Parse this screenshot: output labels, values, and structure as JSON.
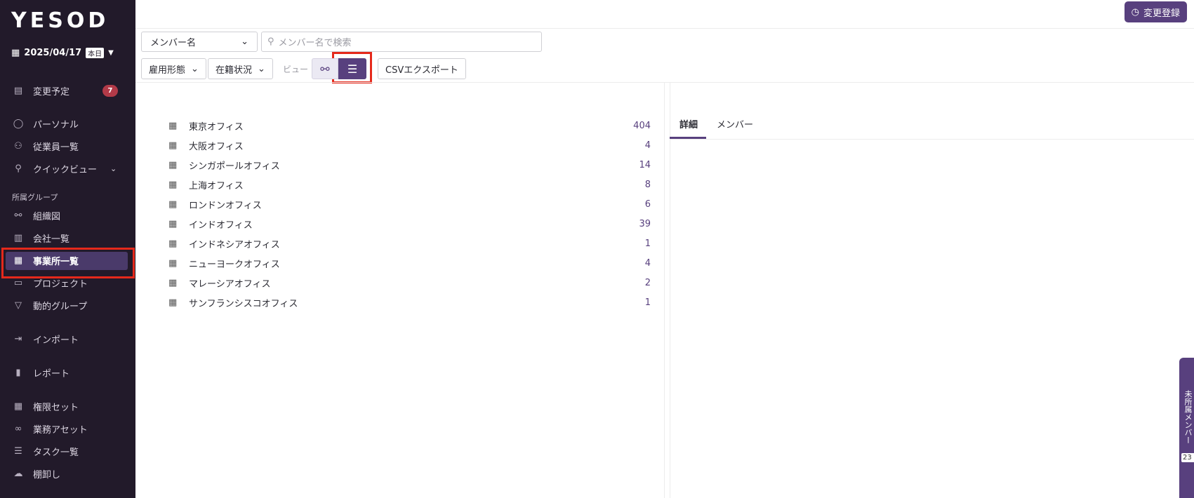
{
  "app": {
    "logo": "YESOD"
  },
  "date": {
    "value": "2025/04/17",
    "today_badge": "本日"
  },
  "sidebar": {
    "items": [
      {
        "label": "変更予定",
        "icon": "document-check-icon",
        "badge": "7"
      },
      {
        "label": "パーソナル",
        "icon": "user-icon"
      },
      {
        "label": "従業員一覧",
        "icon": "users-icon"
      },
      {
        "label": "クイックビュー",
        "icon": "search-icon"
      },
      {
        "label": "組織図",
        "icon": "org-chart-icon"
      },
      {
        "label": "会社一覧",
        "icon": "company-icon"
      },
      {
        "label": "事業所一覧",
        "icon": "building-icon"
      },
      {
        "label": "プロジェクト",
        "icon": "briefcase-icon"
      },
      {
        "label": "動的グループ",
        "icon": "filter-icon"
      },
      {
        "label": "インポート",
        "icon": "import-icon"
      },
      {
        "label": "レポート",
        "icon": "bar-chart-icon"
      },
      {
        "label": "権限セット",
        "icon": "table-icon"
      },
      {
        "label": "業務アセット",
        "icon": "link-icon"
      },
      {
        "label": "タスク一覧",
        "icon": "checklist-icon"
      },
      {
        "label": "棚卸し",
        "icon": "cloud-download-icon"
      }
    ],
    "section_label": "所属グループ"
  },
  "header": {
    "register_button": "変更登録"
  },
  "filters": {
    "field_select": "メンバー名",
    "search_placeholder": "メンバー名で検索",
    "employment_type": "雇用形態",
    "status": "在籍状況",
    "view_label": "ビュー",
    "csv_export": "CSVエクスポート"
  },
  "offices": [
    {
      "name": "東京オフィス",
      "count": "404"
    },
    {
      "name": "大阪オフィス",
      "count": "4"
    },
    {
      "name": "シンガポールオフィス",
      "count": "14"
    },
    {
      "name": "上海オフィス",
      "count": "8"
    },
    {
      "name": "ロンドンオフィス",
      "count": "6"
    },
    {
      "name": "インドオフィス",
      "count": "39"
    },
    {
      "name": "インドネシアオフィス",
      "count": "1"
    },
    {
      "name": "ニューヨークオフィス",
      "count": "4"
    },
    {
      "name": "マレーシアオフィス",
      "count": "2"
    },
    {
      "name": "サンフランシスコオフィス",
      "count": "1"
    }
  ],
  "detail_tabs": {
    "details": "詳細",
    "members": "メンバー"
  },
  "side_panel": {
    "label": "未所属メンバー",
    "count": "23"
  },
  "colors": {
    "sidebar_bg": "#221a2a",
    "accent": "#58407e",
    "highlight": "#e5291b",
    "badge": "#b23a48"
  }
}
